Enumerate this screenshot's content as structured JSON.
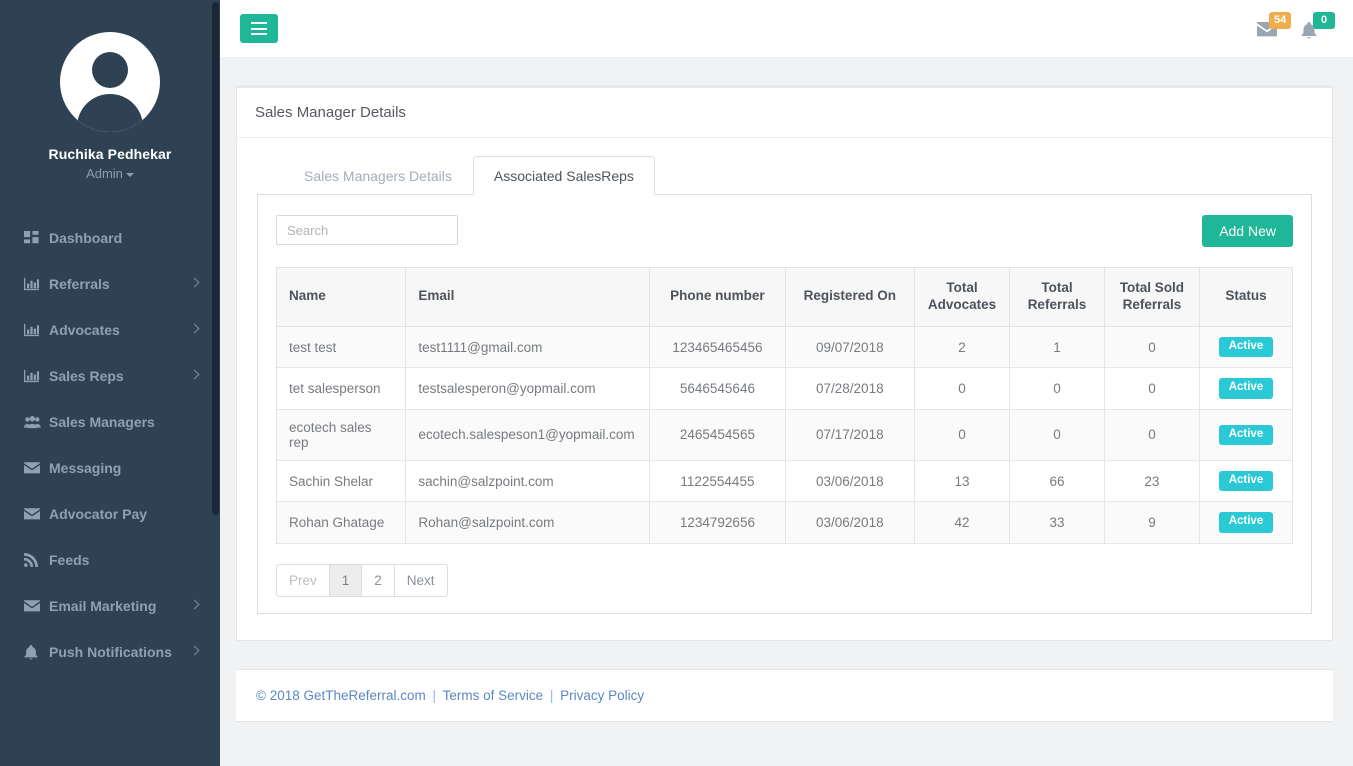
{
  "sidebar": {
    "profile": {
      "name": "Ruchika Pedhekar",
      "role": "Admin",
      "avatar_icon": "user-avatar-icon",
      "caret_icon": "caret-down-icon"
    },
    "items": [
      {
        "label": "Dashboard",
        "icon": "grid-icon",
        "has_arrow": false
      },
      {
        "label": "Referrals",
        "icon": "bar-chart-icon",
        "has_arrow": true
      },
      {
        "label": "Advocates",
        "icon": "bar-chart-icon",
        "has_arrow": true
      },
      {
        "label": "Sales Reps",
        "icon": "bar-chart-icon",
        "has_arrow": true
      },
      {
        "label": "Sales Managers",
        "icon": "users-icon",
        "has_arrow": false
      },
      {
        "label": "Messaging",
        "icon": "envelope-icon",
        "has_arrow": false
      },
      {
        "label": "Advocator Pay",
        "icon": "envelope-icon",
        "has_arrow": false
      },
      {
        "label": "Feeds",
        "icon": "rss-icon",
        "has_arrow": false
      },
      {
        "label": "Email Marketing",
        "icon": "envelope-icon",
        "has_arrow": true
      },
      {
        "label": "Push Notifications",
        "icon": "bell-icon",
        "has_arrow": true
      }
    ]
  },
  "topbar": {
    "menu_toggle_icon": "hamburger-icon",
    "messages": {
      "icon": "envelope-icon",
      "count": "54",
      "color": "#f0ad4e"
    },
    "notifications": {
      "icon": "bell-icon",
      "count": "0",
      "color": "#20b698"
    }
  },
  "panel": {
    "title": "Sales Manager Details"
  },
  "tabs": [
    {
      "label": "Sales Managers Details",
      "active": false
    },
    {
      "label": "Associated SalesReps",
      "active": true
    }
  ],
  "toolbar": {
    "search_placeholder": "Search",
    "search_value": "",
    "add_new_label": "Add New"
  },
  "table": {
    "columns": [
      "Name",
      "Email",
      "Phone number",
      "Registered On",
      "Total Advocates",
      "Total Referrals",
      "Total Sold Referrals",
      "Status"
    ],
    "column_lines": [
      [
        "Name"
      ],
      [
        "Email"
      ],
      [
        "Phone number"
      ],
      [
        "Registered On"
      ],
      [
        "Total",
        "Advocates"
      ],
      [
        "Total",
        "Referrals"
      ],
      [
        "Total Sold",
        "Referrals"
      ],
      [
        "Status"
      ]
    ],
    "rows": [
      {
        "name": "test test",
        "email": "test1111@gmail.com",
        "phone": "123465465456",
        "registered_on": "09/07/2018",
        "total_advocates": "2",
        "total_referrals": "1",
        "total_sold_referrals": "0",
        "status": "Active"
      },
      {
        "name": "tet salesperson",
        "email": "testsalesperon@yopmail.com",
        "phone": "5646545646",
        "registered_on": "07/28/2018",
        "total_advocates": "0",
        "total_referrals": "0",
        "total_sold_referrals": "0",
        "status": "Active"
      },
      {
        "name": "ecotech sales rep",
        "email": "ecotech.salespeson1@yopmail.com",
        "phone": "2465454565",
        "registered_on": "07/17/2018",
        "total_advocates": "0",
        "total_referrals": "0",
        "total_sold_referrals": "0",
        "status": "Active"
      },
      {
        "name": "Sachin Shelar",
        "email": "sachin@salzpoint.com",
        "phone": "1122554455",
        "registered_on": "03/06/2018",
        "total_advocates": "13",
        "total_referrals": "66",
        "total_sold_referrals": "23",
        "status": "Active"
      },
      {
        "name": "Rohan Ghatage",
        "email": "Rohan@salzpoint.com",
        "phone": "1234792656",
        "registered_on": "03/06/2018",
        "total_advocates": "42",
        "total_referrals": "33",
        "total_sold_referrals": "9",
        "status": "Active"
      }
    ]
  },
  "pagination": {
    "prev_label": "Prev",
    "pages": [
      "1",
      "2"
    ],
    "active_page": "1",
    "next_label": "Next"
  },
  "footer": {
    "copyright": "© 2018 GetTheReferral.com",
    "terms_label": "Terms of Service",
    "privacy_label": "Privacy Policy",
    "separator": "|"
  },
  "colors": {
    "sidebar_bg": "#2f4254",
    "accent_green": "#20b698",
    "status_cyan": "#2bc8d6",
    "badge_orange": "#f0ad4e",
    "link_blue": "#5b87c5",
    "page_bg": "#f1f2f3"
  }
}
